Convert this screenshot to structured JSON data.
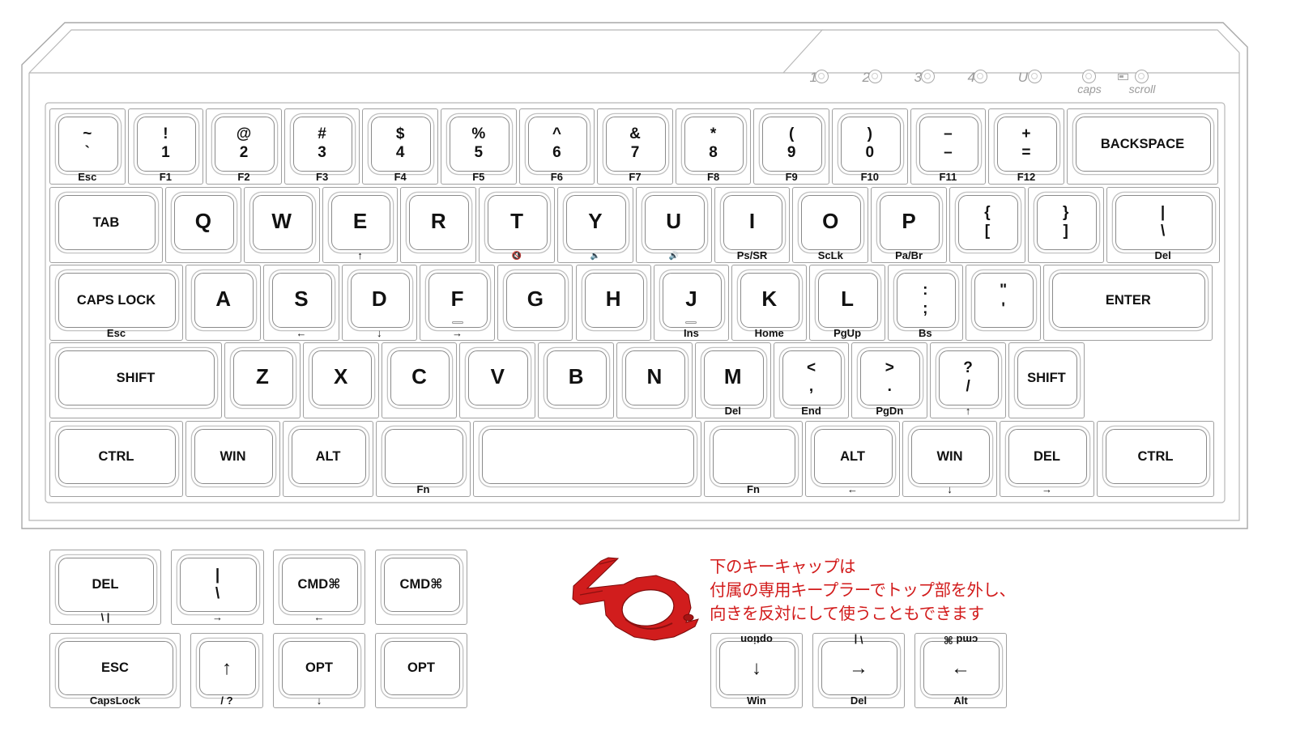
{
  "leds": [
    {
      "label": "1",
      "sub": ""
    },
    {
      "label": "2",
      "sub": ""
    },
    {
      "label": "3",
      "sub": ""
    },
    {
      "label": "4",
      "sub": ""
    },
    {
      "label": "U",
      "sub": ""
    },
    {
      "label": "",
      "sub": "caps"
    },
    {
      "label": "",
      "sub": "scroll"
    }
  ],
  "keyboard": {
    "row1": [
      {
        "name": "key-tilde",
        "top": "~",
        "bottom": "`",
        "sub": "Esc"
      },
      {
        "name": "key-1",
        "top": "!",
        "bottom": "1",
        "sub": "F1"
      },
      {
        "name": "key-2",
        "top": "@",
        "bottom": "2",
        "sub": "F2"
      },
      {
        "name": "key-3",
        "top": "#",
        "bottom": "3",
        "sub": "F3"
      },
      {
        "name": "key-4",
        "top": "$",
        "bottom": "4",
        "sub": "F4"
      },
      {
        "name": "key-5",
        "top": "%",
        "bottom": "5",
        "sub": "F5"
      },
      {
        "name": "key-6",
        "top": "^",
        "bottom": "6",
        "sub": "F6"
      },
      {
        "name": "key-7",
        "top": "&",
        "bottom": "7",
        "sub": "F7"
      },
      {
        "name": "key-8",
        "top": "*",
        "bottom": "8",
        "sub": "F8"
      },
      {
        "name": "key-9",
        "top": "(",
        "bottom": "9",
        "sub": "F9"
      },
      {
        "name": "key-0",
        "top": ")",
        "bottom": "0",
        "sub": "F10"
      },
      {
        "name": "key-minus",
        "top": "–",
        "bottom": "–",
        "sub": "F11"
      },
      {
        "name": "key-equals",
        "top": "+",
        "bottom": "=",
        "sub": "F12"
      },
      {
        "name": "key-backspace",
        "label": "BACKSPACE",
        "sub": ""
      }
    ],
    "row2": [
      {
        "name": "key-tab",
        "label": "TAB",
        "sub": ""
      },
      {
        "name": "key-q",
        "label": "Q",
        "sub": ""
      },
      {
        "name": "key-w",
        "label": "W",
        "sub": ""
      },
      {
        "name": "key-e",
        "label": "E",
        "sub": "↑"
      },
      {
        "name": "key-r",
        "label": "R",
        "sub": ""
      },
      {
        "name": "key-t",
        "label": "T",
        "sub": "🔇"
      },
      {
        "name": "key-y",
        "label": "Y",
        "sub": "🔈"
      },
      {
        "name": "key-u",
        "label": "U",
        "sub": "🔊"
      },
      {
        "name": "key-i",
        "label": "I",
        "sub": "Ps/SR"
      },
      {
        "name": "key-o",
        "label": "O",
        "sub": "ScLk"
      },
      {
        "name": "key-p",
        "label": "P",
        "sub": "Pa/Br"
      },
      {
        "name": "key-lbracket",
        "top": "{",
        "bottom": "[",
        "sub": ""
      },
      {
        "name": "key-rbracket",
        "top": "}",
        "bottom": "]",
        "sub": ""
      },
      {
        "name": "key-backslash",
        "top": "|",
        "bottom": "\\",
        "sub": "Del"
      }
    ],
    "row3": [
      {
        "name": "key-capslock",
        "label": "CAPS LOCK",
        "sub": "Esc"
      },
      {
        "name": "key-a",
        "label": "A",
        "sub": ""
      },
      {
        "name": "key-s",
        "label": "S",
        "sub": "←"
      },
      {
        "name": "key-d",
        "label": "D",
        "sub": "↓"
      },
      {
        "name": "key-f",
        "label": "F",
        "sub": "→"
      },
      {
        "name": "key-g",
        "label": "G",
        "sub": ""
      },
      {
        "name": "key-h",
        "label": "H",
        "sub": ""
      },
      {
        "name": "key-j",
        "label": "J",
        "sub": "Ins"
      },
      {
        "name": "key-k",
        "label": "K",
        "sub": "Home"
      },
      {
        "name": "key-l",
        "label": "L",
        "sub": "PgUp"
      },
      {
        "name": "key-semicolon",
        "top": ":",
        "bottom": ";",
        "sub": "Bs"
      },
      {
        "name": "key-quote",
        "top": "\"",
        "bottom": "'",
        "sub": ""
      },
      {
        "name": "key-enter",
        "label": "ENTER",
        "sub": ""
      }
    ],
    "row4": [
      {
        "name": "key-lshift",
        "label": "SHIFT",
        "sub": ""
      },
      {
        "name": "key-z",
        "label": "Z",
        "sub": ""
      },
      {
        "name": "key-x",
        "label": "X",
        "sub": ""
      },
      {
        "name": "key-c",
        "label": "C",
        "sub": ""
      },
      {
        "name": "key-v",
        "label": "V",
        "sub": ""
      },
      {
        "name": "key-b",
        "label": "B",
        "sub": ""
      },
      {
        "name": "key-n",
        "label": "N",
        "sub": ""
      },
      {
        "name": "key-m",
        "label": "M",
        "sub": "Del"
      },
      {
        "name": "key-comma",
        "top": "<",
        "bottom": ",",
        "sub": "End"
      },
      {
        "name": "key-period",
        "top": ">",
        "bottom": ".",
        "sub": "PgDn"
      },
      {
        "name": "key-slash",
        "top": "?",
        "bottom": "/",
        "sub": "↑"
      },
      {
        "name": "key-rshift",
        "label": "SHIFT",
        "sub": ""
      }
    ],
    "row5": [
      {
        "name": "key-lctrl",
        "label": "CTRL",
        "sub": ""
      },
      {
        "name": "key-lwin",
        "label": "WIN",
        "sub": ""
      },
      {
        "name": "key-lalt",
        "label": "ALT",
        "sub": ""
      },
      {
        "name": "key-lfn",
        "label": "",
        "sub": "Fn"
      },
      {
        "name": "key-space",
        "label": "",
        "sub": ""
      },
      {
        "name": "key-rfn",
        "label": "",
        "sub": "Fn"
      },
      {
        "name": "key-ralt",
        "label": "ALT",
        "sub": "←"
      },
      {
        "name": "key-rwin",
        "label": "WIN",
        "sub": "↓"
      },
      {
        "name": "key-del",
        "label": "DEL",
        "sub": "→"
      },
      {
        "name": "key-rctrl",
        "label": "CTRL",
        "sub": ""
      }
    ]
  },
  "extra": {
    "row1": [
      {
        "name": "extra-key-del",
        "label": "DEL",
        "sub": "\\ |"
      },
      {
        "name": "extra-key-pipe",
        "top": "|",
        "bottom": "\\",
        "sub": "→"
      },
      {
        "name": "extra-key-cmd-1",
        "label": "CMD⌘",
        "sub": "←"
      },
      {
        "name": "extra-key-cmd-2",
        "label": "CMD⌘",
        "sub": ""
      }
    ],
    "row2": [
      {
        "name": "extra-key-esc",
        "label": "ESC",
        "sub": "CapsLock"
      },
      {
        "name": "extra-key-uparrow",
        "label": "↑",
        "sub": "/ ?"
      },
      {
        "name": "extra-key-opt-1",
        "label": "OPT",
        "sub": "↓"
      },
      {
        "name": "extra-key-opt-2",
        "label": "OPT",
        "sub": ""
      }
    ],
    "reversible": [
      {
        "name": "reversible-key-down",
        "label": "↓",
        "upper": "option",
        "sub": "Win"
      },
      {
        "name": "reversible-key-right",
        "label": "→",
        "upper": "\\ |",
        "sub": "Del"
      },
      {
        "name": "reversible-key-left",
        "label": "←",
        "upper": "cmd ⌘",
        "sub": "Alt"
      }
    ]
  },
  "note": {
    "line1": "下のキーキャップは",
    "line2": "付属の専用キープラーでトップ部を外し、",
    "line3": "向きを反対にして使うこともできます"
  },
  "colors": {
    "note_text": "#d21b1b",
    "puller": "#d11d1d",
    "outline": "#a0a0a0"
  }
}
